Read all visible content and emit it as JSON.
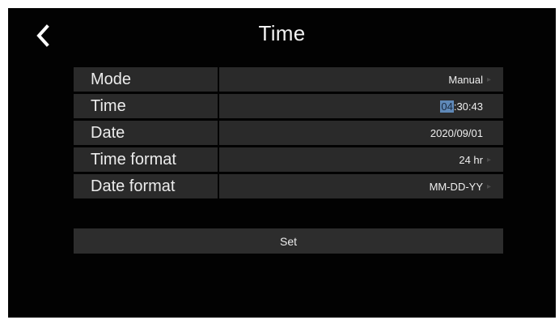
{
  "header": {
    "title": "Time",
    "back_icon": "chevron-left-icon"
  },
  "settings": [
    {
      "label": "Mode",
      "value": "Manual",
      "has_arrow": true
    },
    {
      "label": "Time",
      "hour": "04",
      "minute": "30",
      "second": "43",
      "separator": " : ",
      "has_arrow": false
    },
    {
      "label": "Date",
      "value": "2020/09/01",
      "has_arrow": false
    },
    {
      "label": "Time format",
      "value": "24 hr",
      "has_arrow": true
    },
    {
      "label": "Date format",
      "value": "MM-DD-YY",
      "has_arrow": true
    }
  ],
  "actions": {
    "set_label": "Set"
  },
  "colors": {
    "background": "#020202",
    "row_background": "#2a2a2a",
    "highlight": "#5f89b8"
  }
}
